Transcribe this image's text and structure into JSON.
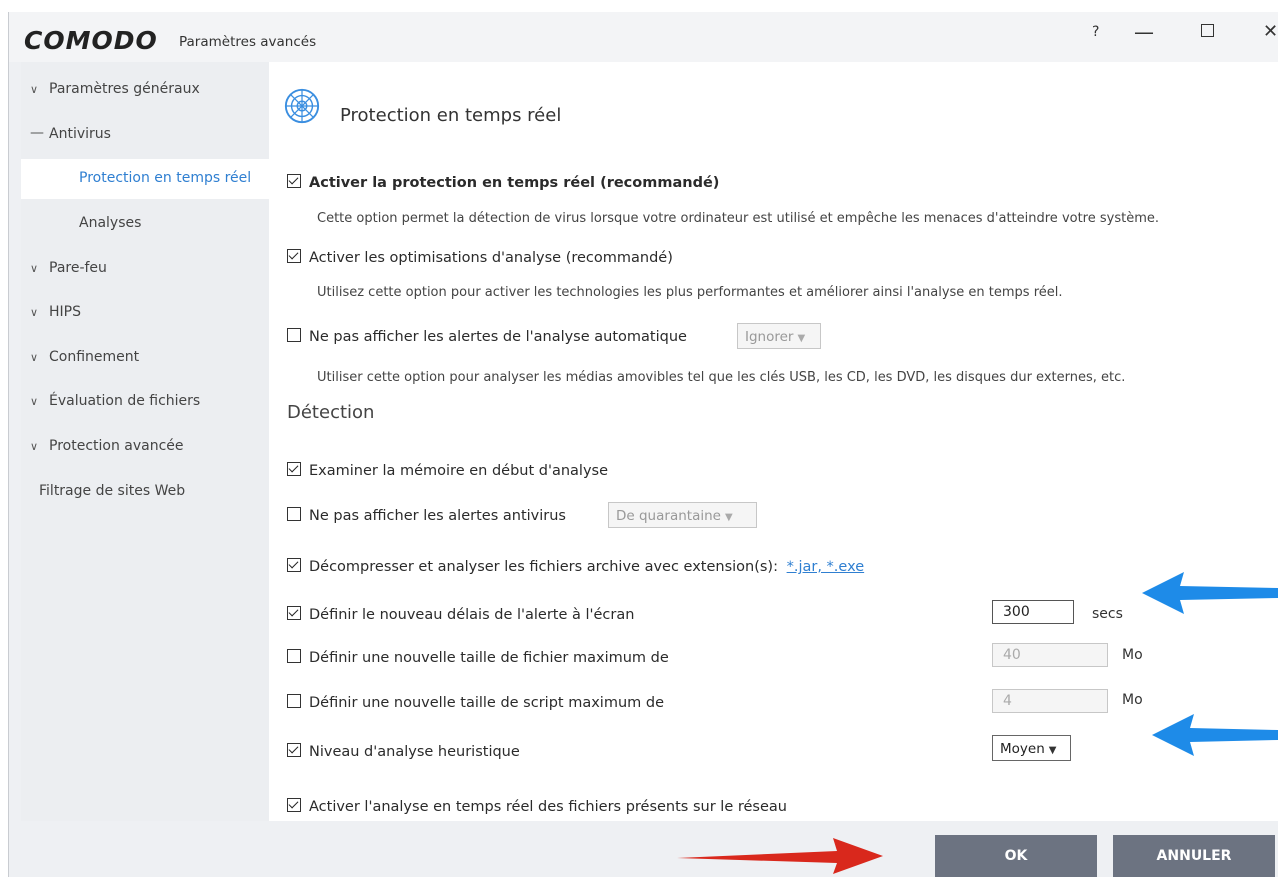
{
  "window": {
    "brand": "COMODO",
    "title": "Paramètres avancés",
    "help": "?",
    "minimize": "—",
    "close": "✕"
  },
  "sidebar": {
    "items": [
      {
        "label": "Paramètres généraux",
        "type": "collapsed"
      },
      {
        "label": "Antivirus",
        "type": "expanded"
      },
      {
        "label": "Protection en temps réel",
        "type": "sub-active"
      },
      {
        "label": "Analyses",
        "type": "sub"
      },
      {
        "label": "Pare-feu",
        "type": "collapsed"
      },
      {
        "label": "HIPS",
        "type": "collapsed"
      },
      {
        "label": "Confinement",
        "type": "collapsed"
      },
      {
        "label": "Évaluation de fichiers",
        "type": "collapsed"
      },
      {
        "label": "Protection avancée",
        "type": "collapsed"
      },
      {
        "label": "Filtrage de sites Web",
        "type": "plain"
      }
    ]
  },
  "main": {
    "title": "Protection en temps réel",
    "options": {
      "realtime": {
        "label": "Activer la protection en temps réel (recommandé)",
        "checked": true,
        "desc": "Cette option permet la détection de virus lorsque votre ordinateur est utilisé et empêche les menaces d'atteindre votre système."
      },
      "optim": {
        "label": "Activer les optimisations d'analyse (recommandé)",
        "checked": true,
        "desc": "Utilisez cette option pour activer les technologies les plus performantes et améliorer ainsi l'analyse en temps réel."
      },
      "noautoalerts": {
        "label": "Ne pas afficher les alertes de l'analyse automatique",
        "checked": false,
        "select": "Ignorer",
        "desc": "Utiliser cette option pour analyser les médias amovibles tel que les clés USB, les CD, les DVD, les disques dur externes, etc."
      }
    },
    "detection": {
      "title": "Détection",
      "memory": {
        "label": "Examiner la mémoire en début d'analyse",
        "checked": true
      },
      "noavalerts": {
        "label": "Ne pas afficher les alertes antivirus",
        "checked": false,
        "select": "De quarantaine"
      },
      "decompress": {
        "label": "Décompresser et analyser les fichiers archive avec extension(s):",
        "checked": true,
        "link": "*.jar, *.exe"
      },
      "alertdelay": {
        "label": "Définir le nouveau délais de l'alerte à l'écran",
        "checked": true,
        "value": "300",
        "unit": "secs"
      },
      "maxfile": {
        "label": "Définir une nouvelle taille de fichier maximum de",
        "checked": false,
        "value": "40",
        "unit": "Mo"
      },
      "maxscript": {
        "label": "Définir une nouvelle taille de script maximum de",
        "checked": false,
        "value": "4",
        "unit": "Mo"
      },
      "heuristic": {
        "label": "Niveau d'analyse heuristique",
        "checked": true,
        "select": "Moyen"
      },
      "network": {
        "label": "Activer l'analyse en temps réel des fichiers présents sur le réseau",
        "checked": true
      }
    }
  },
  "footer": {
    "ok": "OK",
    "cancel": "ANNULER"
  },
  "colors": {
    "accent": "#2f7fd1",
    "button": "#6c7381",
    "annotation_blue": "#1e8be8",
    "annotation_red": "#d9281c"
  }
}
